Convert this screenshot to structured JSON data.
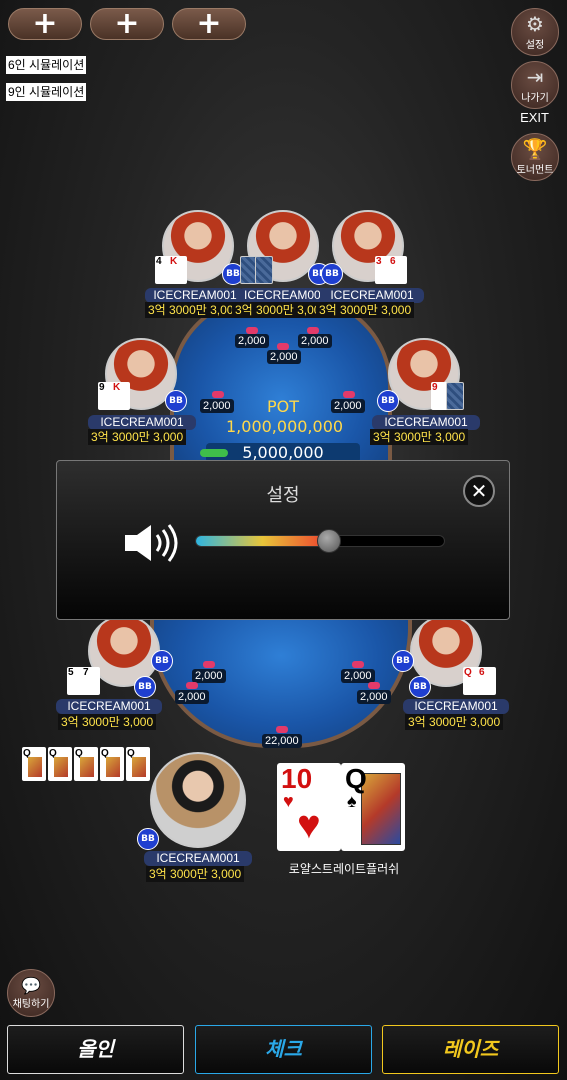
{
  "top_bar": {
    "add_buttons": [
      "+",
      "+",
      "+"
    ],
    "sim_6": "6인 시뮬레이션",
    "sim_9": "9인 시뮬레이션"
  },
  "side_menu": {
    "settings_label": "설정",
    "exit_label": "나가기",
    "exit_text": "EXIT",
    "tournament_label": "토너먼트"
  },
  "table": {
    "pot_label": "POT",
    "pot_amount": "1,000,000,000",
    "main_pot": "5,000,000"
  },
  "players": {
    "name": "ICECREAM001",
    "chips": "3억 3000만 3,000",
    "blind": "BB"
  },
  "top_players": [
    {
      "name": "ICECREAM001",
      "chips": "3억 3000만 3,000",
      "cards": [
        "4",
        "K"
      ]
    },
    {
      "name": "ICECREAM001",
      "chips": "3억 3000만 3,000",
      "cards": [
        "",
        ""
      ]
    },
    {
      "name": "ICECREAM001",
      "chips": "3억 3000만 3,000",
      "cards": [
        "3",
        "6"
      ]
    }
  ],
  "mid_players": [
    {
      "name": "ICECREAM001",
      "chips": "3억 3000만 3,000",
      "cards": [
        "9",
        "K"
      ]
    },
    {
      "name": "ICECREAM001",
      "chips": "3억 3000만 3,000",
      "cards": [
        "9",
        ""
      ]
    }
  ],
  "low_players": [
    {
      "name": "ICECREAM001",
      "chips": "3억 3000만 3,000",
      "cards": [
        "5",
        "7"
      ]
    },
    {
      "name": "ICECREAM001",
      "chips": "3억 3000만 3,000",
      "cards": [
        "Q",
        "6"
      ]
    }
  ],
  "bets": {
    "value": "2,000",
    "center_value": "22,000"
  },
  "me": {
    "name": "ICECREAM001",
    "chips": "3억 3000만 3,000",
    "blind": "BB",
    "hand_name": "로얄스트레이트플러쉬",
    "cards": [
      {
        "rank": "10",
        "suit": "♥",
        "color": "red"
      },
      {
        "rank": "Q",
        "suit": "♠",
        "color": "black"
      }
    ],
    "history": [
      "Q",
      "Q",
      "Q",
      "Q",
      "Q"
    ]
  },
  "settings_modal": {
    "title": "설정",
    "close": "✕",
    "volume": 0.53
  },
  "chat": {
    "label": "채팅하기"
  },
  "actions": {
    "allin": "올인",
    "check": "체크",
    "raise": "레이즈"
  },
  "colors": {
    "check": "#2aa8e8",
    "raise": "#f2c81e",
    "allin": "#ffffff",
    "table": "#1a56a8",
    "chips_text": "#ffe34a"
  },
  "icons": {
    "settings": "gear-icon",
    "exit": "exit-door-icon",
    "tournament": "trophy-icon",
    "speaker": "speaker-icon",
    "chat": "chat-bubble-icon",
    "close": "close-icon"
  }
}
